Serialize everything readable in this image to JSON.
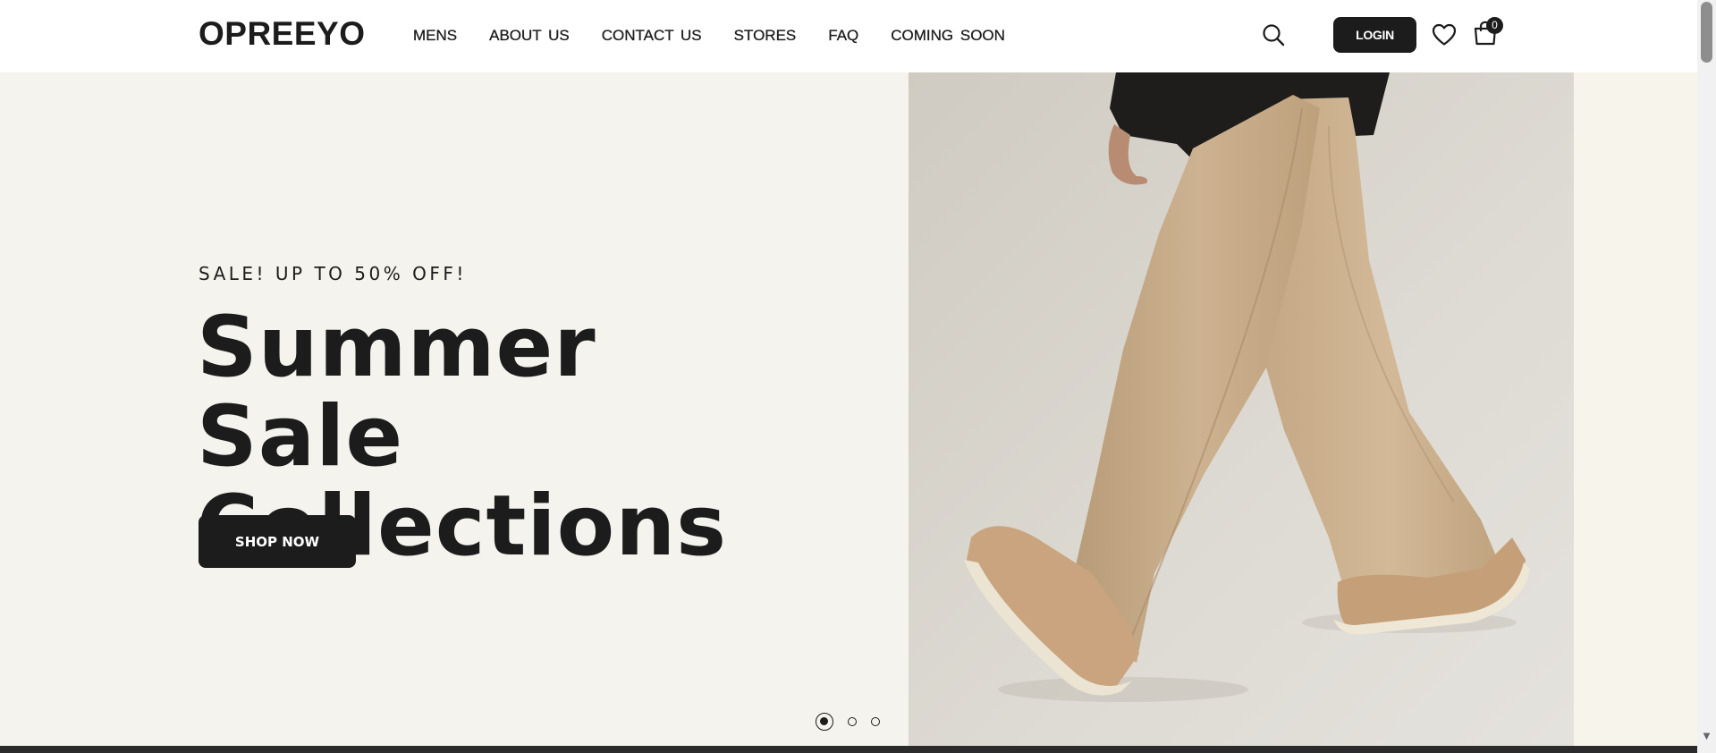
{
  "header": {
    "logo": "OPREEYO",
    "nav": [
      {
        "label": "MENS"
      },
      {
        "label": "ABOUT  US"
      },
      {
        "label": "CONTACT  US"
      },
      {
        "label": "STORES"
      },
      {
        "label": "FAQ"
      },
      {
        "label": "COMING  SOON"
      }
    ],
    "login_label": "LOGIN",
    "cart_count": "0",
    "icons": {
      "search": "search-icon",
      "wishlist": "heart-icon",
      "cart": "shopping-bag-icon"
    }
  },
  "hero": {
    "eyebrow": "SALE! UP TO 50% OFF!",
    "headline_line1": "Summer Sale",
    "headline_line2": "Collections",
    "cta_label": "SHOP NOW",
    "slider": {
      "active_index": 0,
      "total": 3
    },
    "image": "model-wide-beige-trousers-walking"
  },
  "colors": {
    "brand_dark": "#1c1c1c",
    "hero_background": "#f5f3ee",
    "photo_background": "#d8d5cd",
    "trousers": "#c8ad8a"
  }
}
